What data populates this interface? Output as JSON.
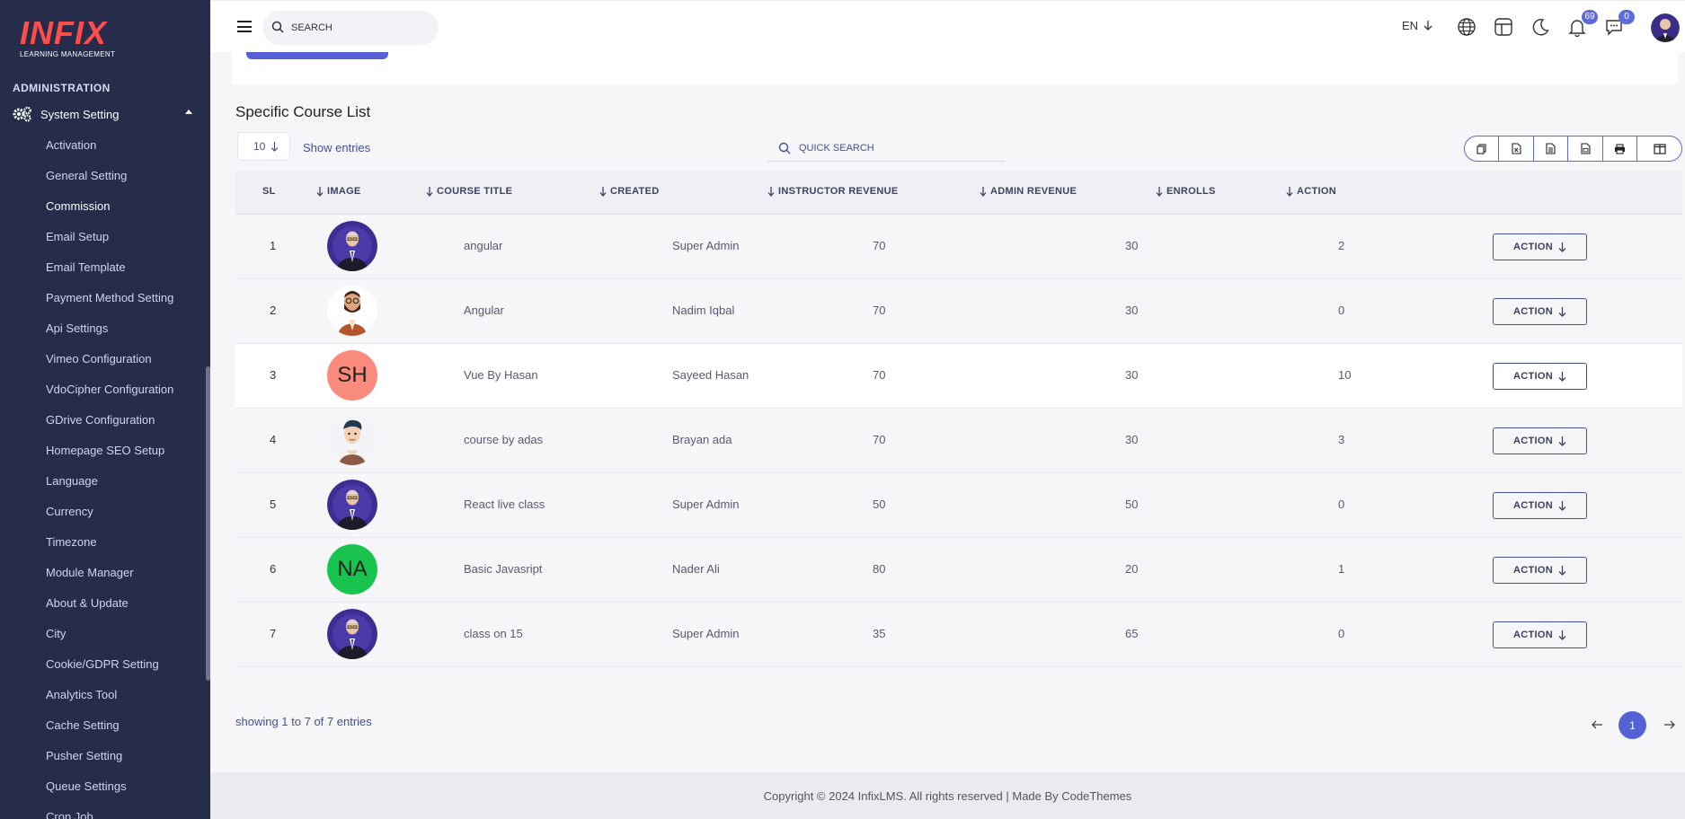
{
  "brand": {
    "logo_text": "INFIX",
    "logo_sub": "LEARNING MANAGEMENT"
  },
  "sidebar": {
    "heading": "ADMINISTRATION",
    "group_label": "System Setting",
    "items": [
      {
        "label": "Activation",
        "active": false
      },
      {
        "label": "General Setting",
        "active": false
      },
      {
        "label": "Commission",
        "active": true
      },
      {
        "label": "Email Setup",
        "active": false
      },
      {
        "label": "Email Template",
        "active": false
      },
      {
        "label": "Payment Method Setting",
        "active": false
      },
      {
        "label": "Api Settings",
        "active": false
      },
      {
        "label": "Vimeo Configuration",
        "active": false
      },
      {
        "label": "VdoCipher Configuration",
        "active": false
      },
      {
        "label": "GDrive Configuration",
        "active": false
      },
      {
        "label": "Homepage SEO Setup",
        "active": false
      },
      {
        "label": "Language",
        "active": false
      },
      {
        "label": "Currency",
        "active": false
      },
      {
        "label": "Timezone",
        "active": false
      },
      {
        "label": "Module Manager",
        "active": false
      },
      {
        "label": "About & Update",
        "active": false
      },
      {
        "label": "City",
        "active": false
      },
      {
        "label": "Cookie/GDPR Setting",
        "active": false
      },
      {
        "label": "Analytics Tool",
        "active": false
      },
      {
        "label": "Cache Setting",
        "active": false
      },
      {
        "label": "Pusher Setting",
        "active": false
      },
      {
        "label": "Queue Settings",
        "active": false
      },
      {
        "label": "Cron Job",
        "active": false
      }
    ]
  },
  "header": {
    "search_placeholder": "SEARCH",
    "language": "EN",
    "notifications_count": "69",
    "messages_count": "0"
  },
  "main": {
    "title": "Specific Course List",
    "entries_value": "10",
    "show_entries_label": "Show entries",
    "quick_search_placeholder": "QUICK SEARCH",
    "columns": [
      "SL",
      "IMAGE",
      "COURSE TITLE",
      "CREATED",
      "INSTRUCTOR REVENUE",
      "ADMIN REVENUE",
      "ENROLLS",
      "ACTION"
    ],
    "rows": [
      {
        "sl": "1",
        "avatar": "photo-suit",
        "initials": "",
        "title": "angular",
        "created": "Super Admin",
        "instructor_revenue": "70",
        "admin_revenue": "30",
        "enrolls": "2",
        "action": "ACTION"
      },
      {
        "sl": "2",
        "avatar": "cartoon-beard",
        "initials": "",
        "title": "Angular",
        "created": "Nadim Iqbal",
        "instructor_revenue": "70",
        "admin_revenue": "30",
        "enrolls": "0",
        "action": "ACTION"
      },
      {
        "sl": "3",
        "avatar": "initials",
        "initials": "SH",
        "title": "Vue By Hasan",
        "created": "Sayeed Hasan",
        "instructor_revenue": "70",
        "admin_revenue": "30",
        "enrolls": "10",
        "action": "ACTION"
      },
      {
        "sl": "4",
        "avatar": "cartoon-boy",
        "initials": "",
        "title": "course by adas",
        "created": "Brayan ada",
        "instructor_revenue": "70",
        "admin_revenue": "30",
        "enrolls": "3",
        "action": "ACTION"
      },
      {
        "sl": "5",
        "avatar": "photo-suit",
        "initials": "",
        "title": "React live class",
        "created": "Super Admin",
        "instructor_revenue": "50",
        "admin_revenue": "50",
        "enrolls": "0",
        "action": "ACTION"
      },
      {
        "sl": "6",
        "avatar": "initials",
        "initials": "NA",
        "title": "Basic Javasript",
        "created": "Nader Ali",
        "instructor_revenue": "80",
        "admin_revenue": "20",
        "enrolls": "1",
        "action": "ACTION"
      },
      {
        "sl": "7",
        "avatar": "photo-suit",
        "initials": "",
        "title": "class on 15",
        "created": "Super Admin",
        "instructor_revenue": "35",
        "admin_revenue": "65",
        "enrolls": "0",
        "action": "ACTION"
      }
    ],
    "showing_text": "showing 1 to 7 of 7 entries",
    "current_page": "1"
  },
  "footer": {
    "text": "Copyright © 2024 InfixLMS. All rights reserved | Made By CodeThemes"
  },
  "colors": {
    "sidebar_bg": "#252d4a",
    "accent": "#5562d6",
    "brand_red": "#ff4d4d",
    "text_primary": "#415094"
  }
}
